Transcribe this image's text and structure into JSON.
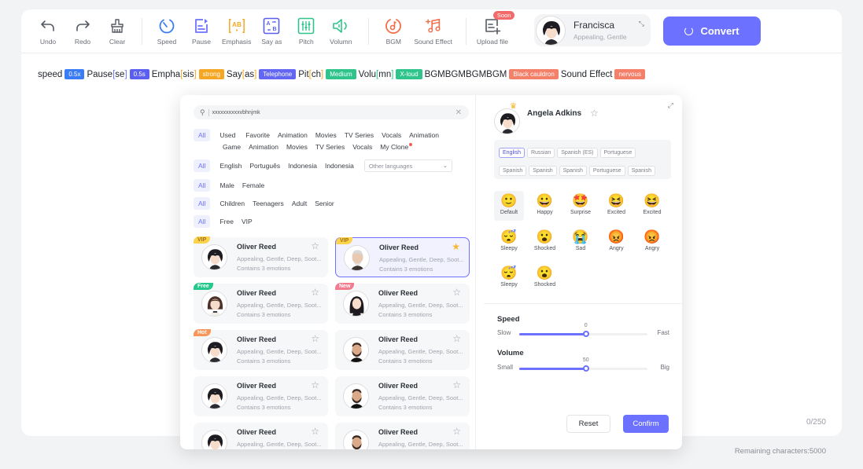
{
  "toolbar": {
    "tools": [
      {
        "label": "Undo",
        "icon": "undo-icon"
      },
      {
        "label": "Redo",
        "icon": "redo-icon"
      },
      {
        "label": "Clear",
        "icon": "brush-icon"
      },
      {
        "label": "Speed",
        "icon": "speed-icon"
      },
      {
        "label": "Pause",
        "icon": "pause-icon"
      },
      {
        "label": "Emphasis",
        "icon": "emphasis-icon"
      },
      {
        "label": "Say as",
        "icon": "say-as-icon"
      },
      {
        "label": "Pitch",
        "icon": "pitch-icon"
      },
      {
        "label": "Volumn",
        "icon": "volume-icon"
      },
      {
        "label": "BGM",
        "icon": "music-disc-icon"
      },
      {
        "label": "Sound Effect",
        "icon": "music-note-icon"
      },
      {
        "label": "Upload file",
        "icon": "upload-file-icon",
        "badge": "Soon"
      }
    ],
    "colors": {
      "undo": "#555a62",
      "speed": "#3a7cf5",
      "pause": "#6c72ff",
      "emphasis": "#f5a623",
      "sayas": "#5b5ff0",
      "pitch": "#2ec48c",
      "volume": "#2ec48c",
      "bgm": "#f26f4a",
      "sfx": "#f26f4a"
    },
    "voice": {
      "name": "Francisca",
      "tags": "Appealing, Gentle"
    },
    "convert_label": "Convert"
  },
  "ssml": [
    {
      "text": "speed",
      "tag": "0.5x",
      "tag_color": "#3a7cf5"
    },
    {
      "text": "Pause",
      "bracket": "se",
      "bracket_color": "br-b",
      "tag": "0.5s",
      "tag_color": "#5b5ff0"
    },
    {
      "text": "Empha",
      "bracket": "sis",
      "bracket_color": "br",
      "tag": "strong",
      "tag_color": "#f5a623"
    },
    {
      "text": "Say ",
      "bracket": "as",
      "bracket_color": "br",
      "tag": "Telephone",
      "tag_color": "#6266f2"
    },
    {
      "text": "Pit ",
      "bracket": "ch",
      "bracket_color": "br",
      "tag": "Medium",
      "tag_color": "#2ec48c"
    },
    {
      "text": "Volu",
      "bracket": "mn",
      "bracket_color": "br-g",
      "tag": "X-loud",
      "tag_color": "#2ec48c"
    },
    {
      "text": "BGMBGMBGMBGM",
      "tag": "Black cauldron",
      "tag_color": "#f5806a"
    },
    {
      "text": "Sound Effect",
      "tag": "nervous",
      "tag_color": "#f5806a"
    }
  ],
  "counter": "0/250",
  "remaining": "Remaining characters:5000",
  "modal": {
    "search": {
      "value": "xxxxxxxxxxvbhnjmk"
    },
    "filters": {
      "category": {
        "all": "All",
        "items": [
          "Used",
          "Favorite",
          "Animation",
          "Movies",
          "TV Series",
          "Vocals",
          "Animation"
        ],
        "items2": [
          "Game",
          "Animation",
          "Movies",
          "TV Series",
          "Vocals",
          "My Clone"
        ]
      },
      "language": {
        "all": "All",
        "items": [
          "English",
          "Português",
          "Indonesia",
          "Indonesia"
        ],
        "other": "Other languages"
      },
      "gender": {
        "all": "All",
        "items": [
          "Male",
          "Female"
        ]
      },
      "age": {
        "all": "All",
        "items": [
          "Children",
          "Teenagers",
          "Adult",
          "Senior"
        ]
      },
      "price": {
        "all": "All",
        "items": [
          "Free",
          "VIP"
        ]
      }
    },
    "voices": [
      {
        "name": "Oliver Reed",
        "desc": "Appealing, Gentle, Deep, Soot...",
        "emotions": "Contains 3 emotions",
        "badge": "VIP",
        "badge_class": "vip",
        "favorite": false,
        "selected": false,
        "avatar": "boy"
      },
      {
        "name": "Oliver Reed",
        "desc": "Appealing, Gentle, Deep, Soot...",
        "emotions": "Contains 3 emotions",
        "badge": "VIP",
        "badge_class": "vip",
        "favorite": true,
        "selected": true,
        "avatar": "old"
      },
      {
        "name": "Oliver Reed",
        "desc": "Appealing, Gentle, Deep, Soot...",
        "emotions": "Contains 3 emotions",
        "badge": "Free",
        "badge_class": "free",
        "favorite": false,
        "selected": false,
        "avatar": "girl"
      },
      {
        "name": "Oliver Reed",
        "desc": "Appealing, Gentle, Deep, Soot...",
        "emotions": "Contains 3 emotions",
        "badge": "New",
        "badge_class": "new",
        "favorite": false,
        "selected": false,
        "avatar": "woman"
      },
      {
        "name": "Oliver Reed",
        "desc": "Appealing, Gentle, Deep, Soot...",
        "emotions": "Contains 3 emotions",
        "badge": "Hot",
        "badge_class": "hot",
        "favorite": false,
        "selected": false,
        "avatar": "boy"
      },
      {
        "name": "Oliver Reed",
        "desc": "Appealing, Gentle, Deep, Soot...",
        "emotions": "Contains 3 emotions",
        "badge": "",
        "favorite": false,
        "selected": false,
        "avatar": "man"
      },
      {
        "name": "Oliver Reed",
        "desc": "Appealing, Gentle, Deep, Soot...",
        "emotions": "Contains 3 emotions",
        "badge": "",
        "favorite": false,
        "selected": false,
        "avatar": "boy"
      },
      {
        "name": "Oliver Reed",
        "desc": "Appealing, Gentle, Deep, Soot...",
        "emotions": "Contains 3 emotions",
        "badge": "",
        "favorite": false,
        "selected": false,
        "avatar": "man"
      },
      {
        "name": "Oliver Reed",
        "desc": "Appealing, Gentle, Deep, Soot...",
        "emotions": "",
        "badge": "",
        "favorite": false,
        "selected": false,
        "avatar": "boy"
      },
      {
        "name": "Oliver Reed",
        "desc": "Appealing, Gentle, Deep, Soot...",
        "emotions": "",
        "badge": "",
        "favorite": false,
        "selected": false,
        "avatar": "man"
      }
    ],
    "detail": {
      "name": "Angela Adkins",
      "languages": [
        {
          "label": "English",
          "selected": true
        },
        {
          "label": "Russian"
        },
        {
          "label": "Spanish (ES)"
        },
        {
          "label": "Portuguese"
        },
        {
          "label": "Spanish"
        },
        {
          "label": "Spanish"
        },
        {
          "label": "Spanish"
        },
        {
          "label": "Portuguese"
        },
        {
          "label": "Spanish"
        }
      ],
      "emotions": [
        {
          "label": "Default",
          "face": "🙂",
          "selected": true
        },
        {
          "label": "Happy",
          "face": "😀"
        },
        {
          "label": "Surprise",
          "face": "🤩"
        },
        {
          "label": "Excited",
          "face": "😆"
        },
        {
          "label": "Excited",
          "face": "😆"
        },
        {
          "label": "Sleepy",
          "face": "😴"
        },
        {
          "label": "Shocked",
          "face": "😮"
        },
        {
          "label": "Sad",
          "face": "😭"
        },
        {
          "label": "Angry",
          "face": "😡"
        },
        {
          "label": "Angry",
          "face": "😡"
        },
        {
          "label": "Sleepy",
          "face": "😴"
        },
        {
          "label": "Shocked",
          "face": "😮"
        }
      ],
      "speed": {
        "title": "Speed",
        "low": "Slow",
        "high": "Fast",
        "value": "0",
        "fill_fraction": 0.52
      },
      "volume": {
        "title": "Volume",
        "low": "Small",
        "high": "Big",
        "value": "50",
        "fill_fraction": 0.52
      },
      "reset_label": "Reset",
      "confirm_label": "Confirm"
    }
  }
}
